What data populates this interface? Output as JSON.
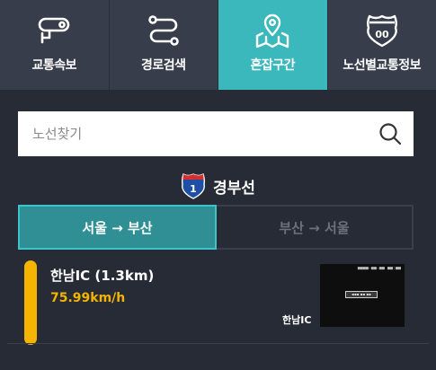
{
  "nav": {
    "items": [
      {
        "label": "교통속보",
        "icon": "cctv-camera-icon",
        "active": false
      },
      {
        "label": "경로검색",
        "icon": "route-path-icon",
        "active": false
      },
      {
        "label": "혼잡구간",
        "icon": "map-pin-icon",
        "active": true
      },
      {
        "label": "노선별교통정보",
        "icon": "highway-shield-icon",
        "active": false
      }
    ],
    "badge_text": "00"
  },
  "search": {
    "placeholder": "노선찾기",
    "value": ""
  },
  "route": {
    "badge_number": "1",
    "name": "경부선"
  },
  "direction_tabs": [
    {
      "label": "서울 → 부산",
      "active": true
    },
    {
      "label": "부산 → 서울",
      "active": false
    }
  ],
  "list": [
    {
      "name": "한남IC (1.3km)",
      "speed": "75.99km/h",
      "cctv_label": "한남IC"
    }
  ],
  "colors": {
    "accent": "#3bb8bb",
    "nav_bg": "#383d4c",
    "content_bg": "#262b35",
    "speed_yellow": "#f5b400",
    "active_tab": "#2f8f94"
  }
}
